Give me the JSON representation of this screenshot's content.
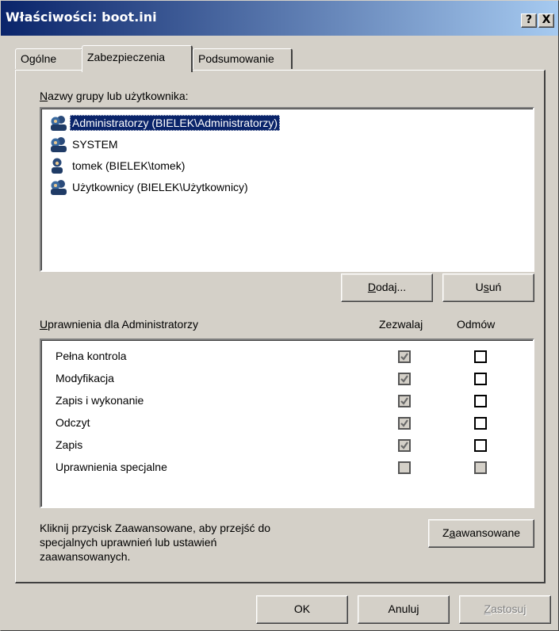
{
  "window": {
    "title": "Właściwości: boot.ini",
    "help_btn": "?",
    "close_btn": "X"
  },
  "tabs": [
    {
      "label": "Ogólne",
      "active": false
    },
    {
      "label": "Zabezpieczenia",
      "active": true
    },
    {
      "label": "Podsumowanie",
      "active": false
    }
  ],
  "users": {
    "label_pre": "",
    "label_u": "N",
    "label_post": "azwy grupy lub użytkownika:",
    "items": [
      {
        "label": "Administratorzy (BIELEK\\Administratorzy)",
        "icon": "group-icon",
        "selected": true
      },
      {
        "label": "SYSTEM",
        "icon": "group-icon",
        "selected": false
      },
      {
        "label": "tomek (BIELEK\\tomek)",
        "icon": "user-icon",
        "selected": false
      },
      {
        "label": "Użytkownicy (BIELEK\\Użytkownicy)",
        "icon": "group-icon",
        "selected": false
      }
    ],
    "add_u": "D",
    "add_rest": "odaj...",
    "remove_pre": "U",
    "remove_u": "s",
    "remove_post": "uń"
  },
  "permissions": {
    "label_u": "U",
    "label_post": "prawnienia dla Administratorzy",
    "allow_header": "Zezwalaj",
    "deny_header": "Odmów",
    "rows": [
      {
        "name": "Pełna kontrola",
        "allow": "checked-gray",
        "deny": "empty"
      },
      {
        "name": "Modyfikacja",
        "allow": "checked-gray",
        "deny": "empty"
      },
      {
        "name": "Zapis i wykonanie",
        "allow": "checked-gray",
        "deny": "empty"
      },
      {
        "name": "Odczyt",
        "allow": "checked-gray",
        "deny": "empty"
      },
      {
        "name": "Zapis",
        "allow": "checked-gray",
        "deny": "empty"
      },
      {
        "name": "Uprawnienia specjalne",
        "allow": "grayed",
        "deny": "grayed"
      }
    ]
  },
  "advanced": {
    "hint_line1": "Kliknij przycisk Zaawansowane, aby przejść do",
    "hint_line2": "specjalnych uprawnień lub ustawień",
    "hint_line3": "zaawansowanych.",
    "button_pre": "Z",
    "button_u": "a",
    "button_post": "awansowane"
  },
  "footer": {
    "ok": "OK",
    "cancel": "Anuluj",
    "apply_u": "Z",
    "apply_post": "astosuj"
  }
}
